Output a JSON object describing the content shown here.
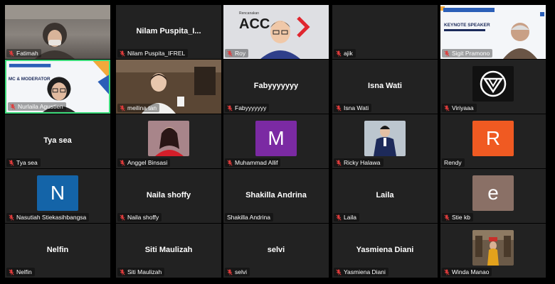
{
  "colors": {
    "tile_bg": "#222222",
    "window_bg": "#000000",
    "active_border": "#3fdc7c",
    "mic_muted": "#e03c3c",
    "name_text": "#ffffff"
  },
  "participants": [
    {
      "label": "Fatimah",
      "muted": true,
      "display": "video"
    },
    {
      "label": "Nilam Puspita_IFREL",
      "muted": true,
      "display": "name",
      "name": "Nilam  Puspita_I..."
    },
    {
      "label": "Roy",
      "muted": true,
      "display": "video",
      "screen_text": "ACCESS"
    },
    {
      "label": "ajik",
      "muted": true,
      "display": "blank"
    },
    {
      "label": "Sigit Pramono",
      "muted": true,
      "display": "video",
      "screen_text": "KEYNOTE SPEAKER"
    },
    {
      "label": "Nurlaila Agustien",
      "muted": true,
      "display": "video",
      "screen_text": "MC & MODERATOR",
      "active": true
    },
    {
      "label": "meilina tan",
      "muted": true,
      "display": "video"
    },
    {
      "label": "Fabyyyyyyy",
      "muted": true,
      "display": "name",
      "name": "Fabyyyyyyy"
    },
    {
      "label": "Isna Wati",
      "muted": true,
      "display": "name",
      "name": "Isna Wati"
    },
    {
      "label": "Viriyaaa",
      "muted": true,
      "display": "logo",
      "icon": "viriyaaa-logo-icon"
    },
    {
      "label": "Tya sea",
      "muted": true,
      "display": "name",
      "name": "Tya sea"
    },
    {
      "label": "Anggel Binsasi",
      "muted": true,
      "display": "photo"
    },
    {
      "label": "Muhammad Allif",
      "muted": true,
      "display": "avatar",
      "letter": "M",
      "color": "#7b2aa3"
    },
    {
      "label": "Ricky Halawa",
      "muted": true,
      "display": "photo"
    },
    {
      "label": "Rendy",
      "muted": false,
      "display": "avatar",
      "letter": "R",
      "color": "#f05a22"
    },
    {
      "label": "Nasutiah Stiekasihbangsa",
      "muted": true,
      "display": "avatar",
      "letter": "N",
      "color": "#1464a8"
    },
    {
      "label": "Naila shoffy",
      "muted": true,
      "display": "name",
      "name": "Naila shoffy"
    },
    {
      "label": "Shakilla Andrina",
      "muted": false,
      "display": "name",
      "name": "Shakilla Andrina"
    },
    {
      "label": "Laila",
      "muted": true,
      "display": "name",
      "name": "Laila"
    },
    {
      "label": "Stie kb",
      "muted": true,
      "display": "avatar",
      "letter": "e",
      "color": "#8a7066"
    },
    {
      "label": "Nelfin",
      "muted": true,
      "display": "name",
      "name": "Nelfin"
    },
    {
      "label": "Siti Maulizah",
      "muted": true,
      "display": "name",
      "name": "Siti Maulizah"
    },
    {
      "label": "selvi",
      "muted": true,
      "display": "name",
      "name": "selvi"
    },
    {
      "label": "Yasmiena Diani",
      "muted": true,
      "display": "name",
      "name": "Yasmiena Diani"
    },
    {
      "label": "Winda Manao",
      "muted": true,
      "display": "photo"
    }
  ]
}
